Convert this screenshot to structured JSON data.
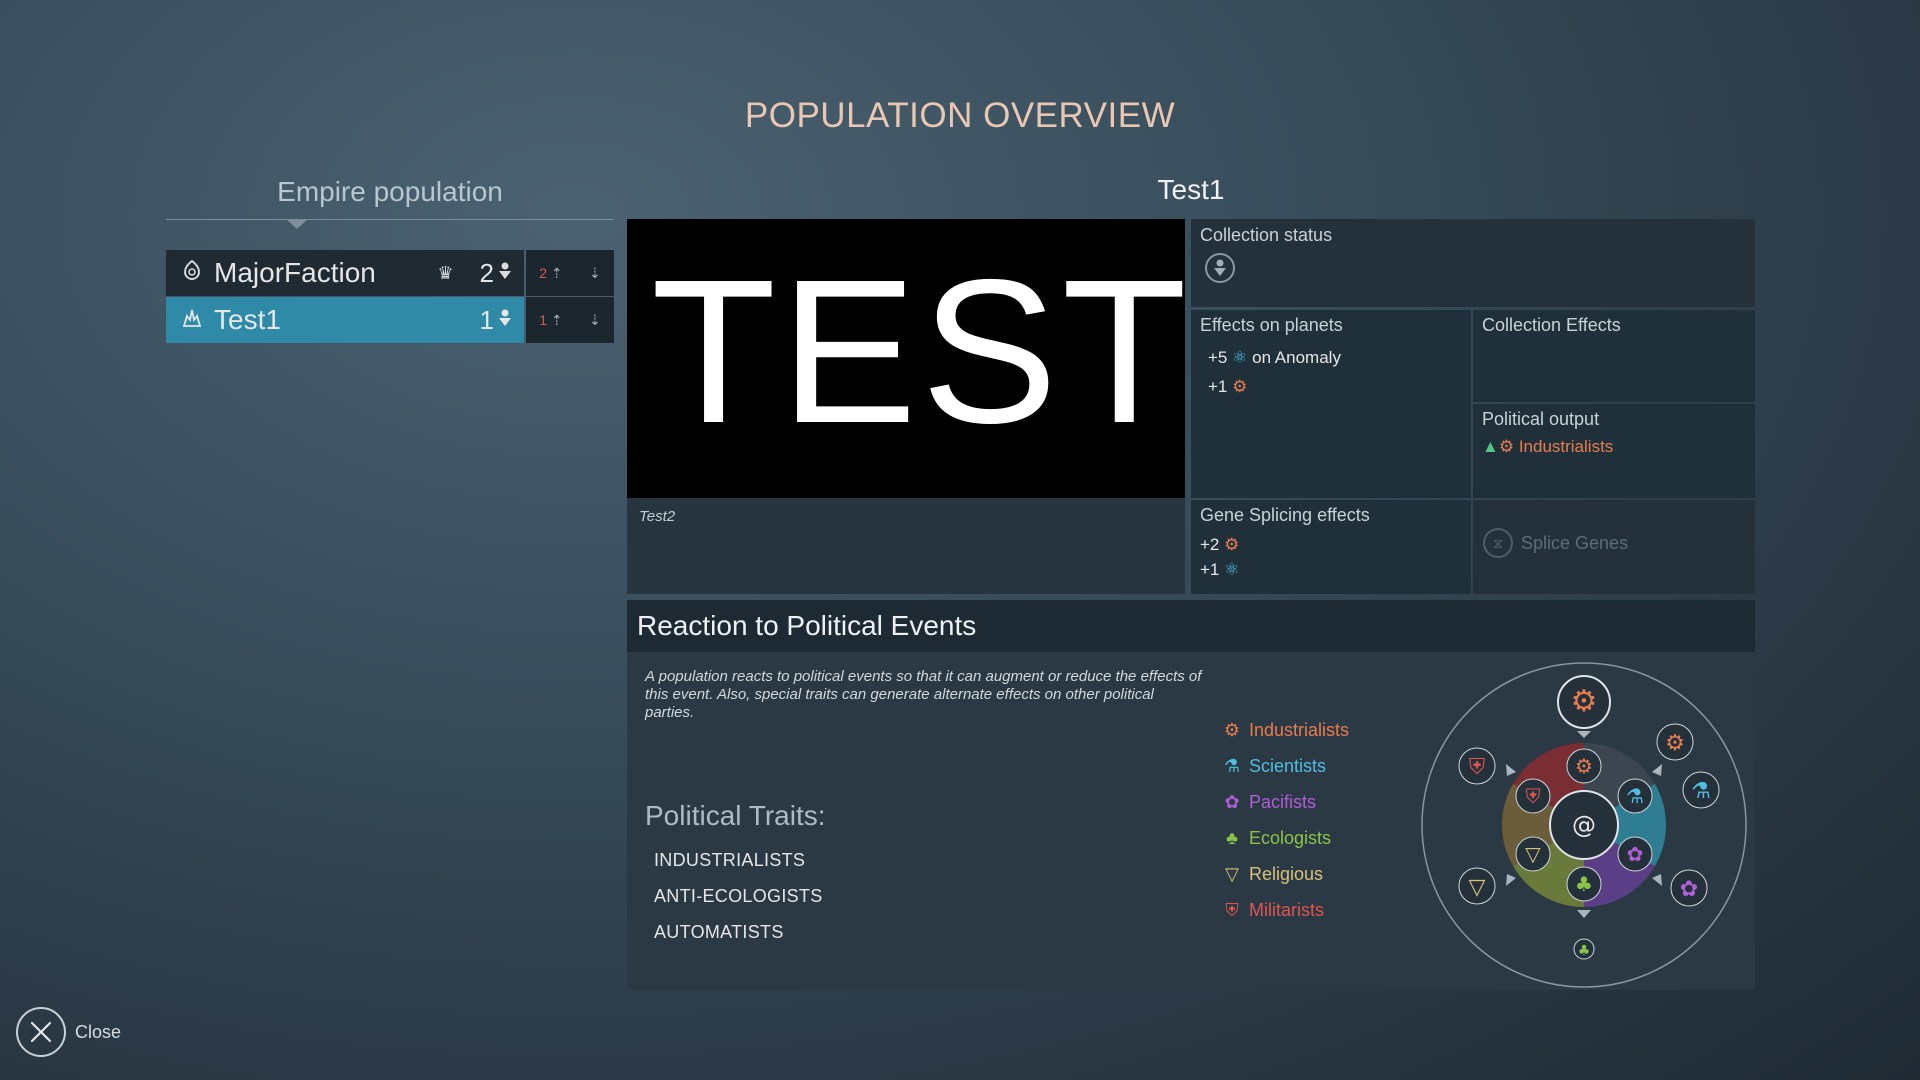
{
  "screen_title": "POPULATION OVERVIEW",
  "empire": {
    "title": "Empire population",
    "rows": [
      {
        "name": "MajorFaction",
        "count": "2",
        "side_value": "2",
        "selected": false
      },
      {
        "name": "Test1",
        "count": "1",
        "side_value": "1",
        "selected": true
      }
    ]
  },
  "selected": {
    "name": "Test1",
    "image_text": "TEST",
    "description": "Test2",
    "collection_status_label": "Collection status",
    "effects_planets_label": "Effects on planets",
    "effects_planets": [
      {
        "value": "+5",
        "suffix": "on Anomaly"
      },
      {
        "value": "+1",
        "suffix": ""
      }
    ],
    "collection_effects_label": "Collection Effects",
    "political_output_label": "Political output",
    "political_output_value": "Industrialists",
    "gene_label": "Gene Splicing effects",
    "gene_effects": [
      {
        "value": "+2"
      },
      {
        "value": "+1"
      }
    ],
    "splice_label": "Splice Genes"
  },
  "reaction": {
    "title": "Reaction to Political Events",
    "description": "A population reacts to political events so that it can augment or reduce the effects of this event. Also, special traits can generate alternate effects on other political parties.",
    "traits_title": "Political Traits:",
    "traits": [
      "INDUSTRIALISTS",
      "ANTI-ECOLOGISTS",
      "AUTOMATISTS"
    ],
    "legend": [
      {
        "label": "Industrialists",
        "color": "#e87c4f"
      },
      {
        "label": "Scientists",
        "color": "#52bde0"
      },
      {
        "label": "Pacifists",
        "color": "#b15ed8"
      },
      {
        "label": "Ecologists",
        "color": "#8bc34a"
      },
      {
        "label": "Religious",
        "color": "#d8c27a"
      },
      {
        "label": "Militarists",
        "color": "#e0554f"
      }
    ]
  },
  "close_label": "Close"
}
